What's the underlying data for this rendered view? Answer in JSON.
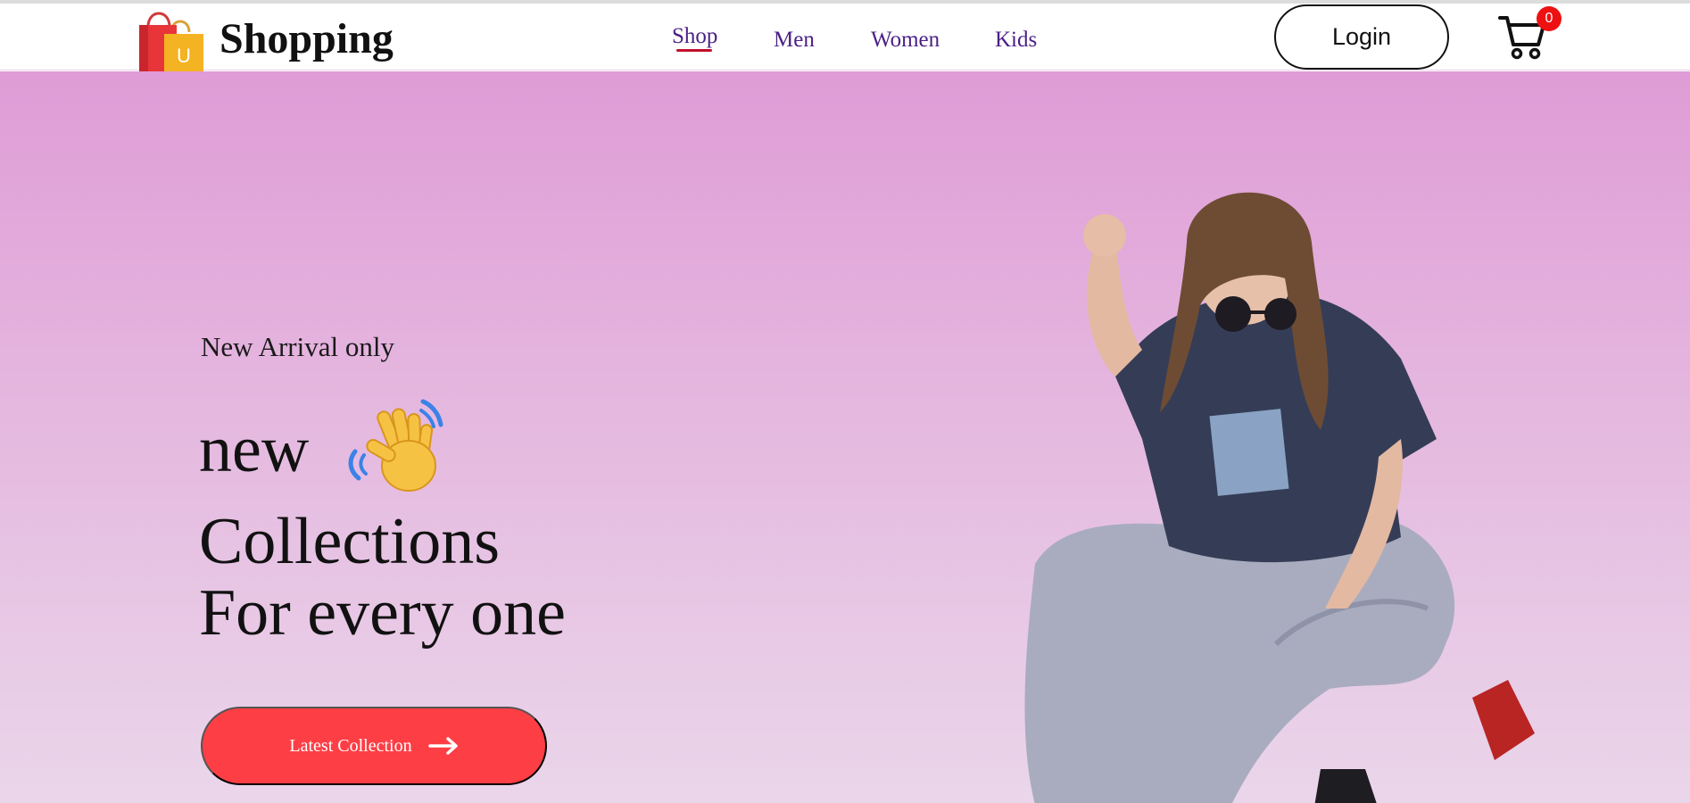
{
  "navbar": {
    "brand": "Shopping",
    "logo_icon": "shopping-bags-icon",
    "logo_letter": "U",
    "links": [
      {
        "label": "Shop",
        "active": true
      },
      {
        "label": "Men",
        "active": false
      },
      {
        "label": "Women",
        "active": false
      },
      {
        "label": "Kids",
        "active": false
      }
    ],
    "login_label": "Login",
    "cart_icon": "cart-icon",
    "cart_count": "0"
  },
  "hero": {
    "tagline": "New Arrival only",
    "headline_word": "new",
    "wave_icon": "waving-hand-icon",
    "headline_line2": "Collections",
    "headline_line3": "For every one",
    "cta_label": "Latest Collection",
    "cta_icon": "arrow-right-icon",
    "model_image": "model-photo"
  },
  "colors": {
    "accent": "#fe3e45",
    "nav_link": "#4b1f86",
    "nav_underline": "#c0102a",
    "hero_top": "#df9cd6",
    "hero_bottom": "#ead6ea",
    "badge": "#ee1111"
  }
}
